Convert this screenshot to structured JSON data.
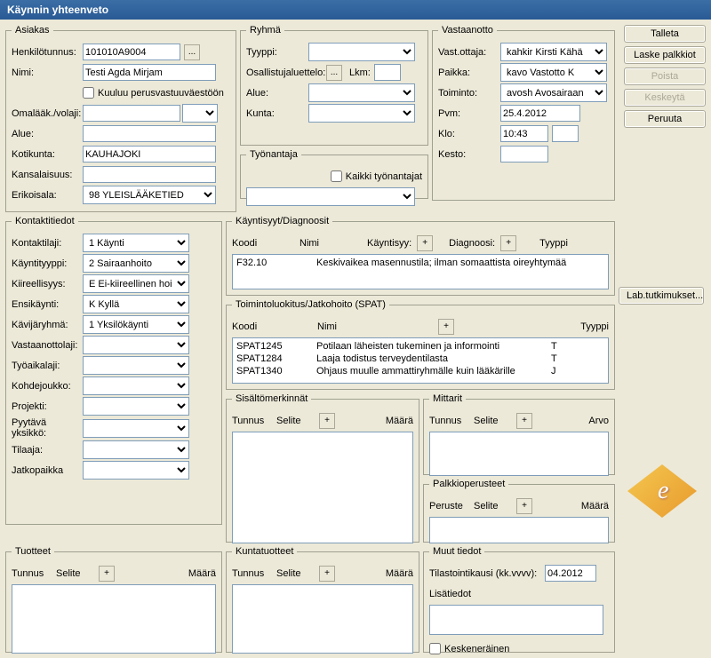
{
  "window": {
    "title": "Käynnin yhteenveto"
  },
  "buttons": {
    "talleta": "Talleta",
    "laske_palkkiot": "Laske palkkiot",
    "poista": "Poista",
    "keskeyta": "Keskeytä",
    "peruuta": "Peruuta",
    "lab": "Lab.tutkimukset..."
  },
  "asiakas": {
    "legend": "Asiakas",
    "henkilotunnus_label": "Henkilötunnus:",
    "henkilotunnus": "101010A9004",
    "nimi_label": "Nimi:",
    "nimi": "Testi Agda Mirjam",
    "perusvast_label": "Kuuluu perusvastuuväestöön",
    "omalaak_label": "Omalääk./volaji:",
    "omalaak": "",
    "alue_label": "Alue:",
    "alue": "",
    "kotikunta_label": "Kotikunta:",
    "kotikunta": "KAUHAJOKI",
    "kansalaisuus_label": "Kansalaisuus:",
    "kansalaisuus": "",
    "erikoisala_label": "Erikoisala:",
    "erikoisala": "98     YLEISLÄÄKETIED"
  },
  "ryhma": {
    "legend": "Ryhmä",
    "tyyppi_label": "Tyyppi:",
    "osallistuja_label": "Osallistujaluettelo:",
    "lkm_label": "Lkm:",
    "alue_label": "Alue:",
    "kunta_label": "Kunta:"
  },
  "tyonantaja": {
    "legend": "Työnantaja",
    "kaikki_label": "Kaikki työnantajat"
  },
  "vastaanotto": {
    "legend": "Vastaanotto",
    "vastottaja_label": "Vast.ottaja:",
    "vastottaja": "kahkir     Kirsti Kähä",
    "paikka_label": "Paikka:",
    "paikka": "kavo       Vastotto K",
    "toiminto_label": "Toiminto:",
    "toiminto": "avosh     Avosairaan",
    "pvm_label": "Pvm:",
    "pvm": "25.4.2012",
    "klo_label": "Klo:",
    "klo": "10:43",
    "kesto_label": "Kesto:"
  },
  "kontaktitiedot": {
    "legend": "Kontaktitiedot",
    "kontaktilaji_label": "Kontaktilaji:",
    "kontaktilaji": "1   Käynti",
    "kayntityyppi_label": "Käyntityyppi:",
    "kayntityyppi": "2   Sairaanhoito",
    "kiireellisyys_label": "Kiireellisyys:",
    "kiireellisyys": "E   Ei-kiireellinen hoi",
    "ensikaynti_label": "Ensikäynti:",
    "ensikaynti": "K   Kyllä",
    "kavijaryhma_label": "Kävijäryhmä:",
    "kavijaryhma": "1   Yksilökäynti",
    "vastaanottolaji_label": "Vastaanottolaji:",
    "tyoaikalaji_label": "Työaikalaji:",
    "kohdejoukko_label": "Kohdejoukko:",
    "projekti_label": "Projekti:",
    "pyytava_label": "Pyytävä yksikkö:",
    "tilaaja_label": "Tilaaja:",
    "jatkopaikka_label": "Jatkopaikka"
  },
  "kayntisyyt": {
    "legend": "Käyntisyyt/Diagnoosit",
    "hdr_koodi": "Koodi",
    "hdr_nimi": "Nimi",
    "hdr_kayntisyy": "Käyntisyy:",
    "hdr_diagnoosi": "Diagnoosi:",
    "hdr_tyyppi": "Tyyppi",
    "rows": [
      {
        "koodi": "F32.10",
        "nimi": "Keskivaikea masennustila; ilman somaattista oireyhtymää"
      }
    ]
  },
  "toimintoluokitus": {
    "legend": "Toimintoluokitus/Jatkohoito (SPAT)",
    "hdr_koodi": "Koodi",
    "hdr_nimi": "Nimi",
    "hdr_tyyppi": "Tyyppi",
    "rows": [
      {
        "koodi": "SPAT1245",
        "nimi": "Potilaan läheisten tukeminen ja informointi",
        "tyyppi": "T"
      },
      {
        "koodi": "SPAT1284",
        "nimi": "Laaja todistus terveydentilasta",
        "tyyppi": "T"
      },
      {
        "koodi": "SPAT1340",
        "nimi": "Ohjaus muulle ammattiryhmälle kuin lääkärille",
        "tyyppi": "J"
      }
    ]
  },
  "sisaltomerk": {
    "legend": "Sisältömerkinnät",
    "hdr_tunnus": "Tunnus",
    "hdr_selite": "Selite",
    "hdr_maara": "Määrä"
  },
  "mittarit": {
    "legend": "Mittarit",
    "hdr_tunnus": "Tunnus",
    "hdr_selite": "Selite",
    "hdr_arvo": "Arvo"
  },
  "palkkioperusteet": {
    "legend": "Palkkioperusteet",
    "hdr_peruste": "Peruste",
    "hdr_selite": "Selite",
    "hdr_maara": "Määrä"
  },
  "tuotteet": {
    "legend": "Tuotteet",
    "hdr_tunnus": "Tunnus",
    "hdr_selite": "Selite",
    "hdr_maara": "Määrä"
  },
  "kuntatuotteet": {
    "legend": "Kuntatuotteet",
    "hdr_tunnus": "Tunnus",
    "hdr_selite": "Selite",
    "hdr_maara": "Määrä"
  },
  "muut": {
    "legend": "Muut tiedot",
    "tilastointikausi_label": "Tilastointikausi (kk.vvvv):",
    "tilastointikausi": "04.2012",
    "lisatiedot_label": "Lisätiedot",
    "keskenerainen_label": "Keskeneräinen"
  }
}
